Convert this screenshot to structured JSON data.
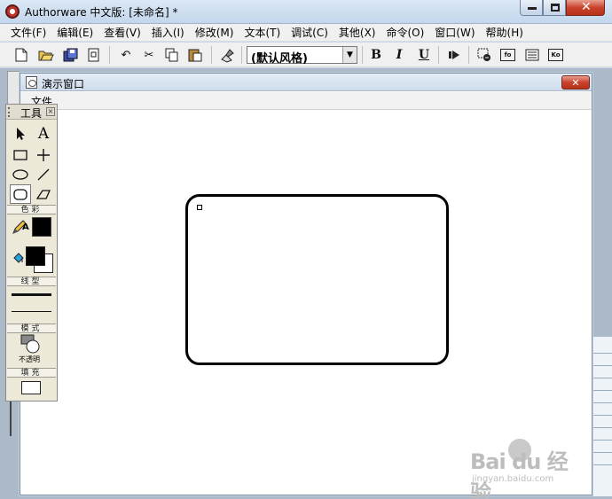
{
  "window": {
    "title": "Authorware 中文版: [未命名] *"
  },
  "menu": [
    "文件(F)",
    "编辑(E)",
    "查看(V)",
    "插入(I)",
    "修改(M)",
    "文本(T)",
    "调试(C)",
    "其他(X)",
    "命令(O)",
    "窗口(W)",
    "帮助(H)"
  ],
  "toolbar": {
    "style_select": "(默认风格)",
    "bold": "B",
    "italic": "I",
    "underline": "U",
    "btn_fn": "fo",
    "btn_ko": "Ko"
  },
  "presentation": {
    "title": "演示窗口",
    "menu_file": "文件"
  },
  "tools": {
    "title": "工具",
    "text_tool": "A",
    "section_color": "色彩",
    "section_line": "线型",
    "section_mode": "模式",
    "mode_value": "不透明",
    "section_fill": "填充",
    "pencil_text": "A"
  },
  "watermark": {
    "logo": "Bai du 经验",
    "url": "jingyan.baidu.com"
  },
  "colors": {
    "title_bg": "#c3d6ec",
    "close_red": "#c9422c",
    "foreground_swatch": "#000000",
    "background_swatch": "#ffffff"
  }
}
